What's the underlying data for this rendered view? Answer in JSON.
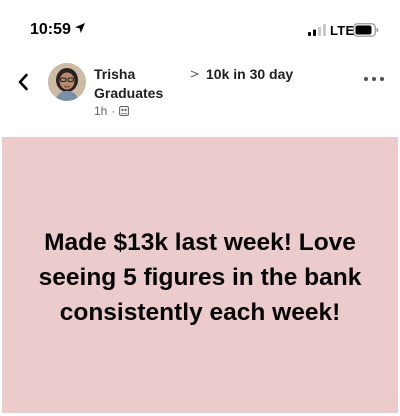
{
  "status_bar": {
    "time": "10:59",
    "network": "LTE",
    "icons": [
      "location-arrow-icon",
      "signal-bars-icon",
      "battery-icon"
    ]
  },
  "post_header": {
    "back_icon": "chevron-left-icon",
    "author": "Trisha",
    "group_line": "Graduates",
    "group_name": "10k in 30 day",
    "timestamp": "1h",
    "separator": "·",
    "privacy_icon": "group-icon",
    "more_icon": "ellipsis-icon"
  },
  "post": {
    "background_color": "#eccbcd",
    "text": "Made $13k last week! Love seeing 5 figures in the bank consistently each week!"
  }
}
